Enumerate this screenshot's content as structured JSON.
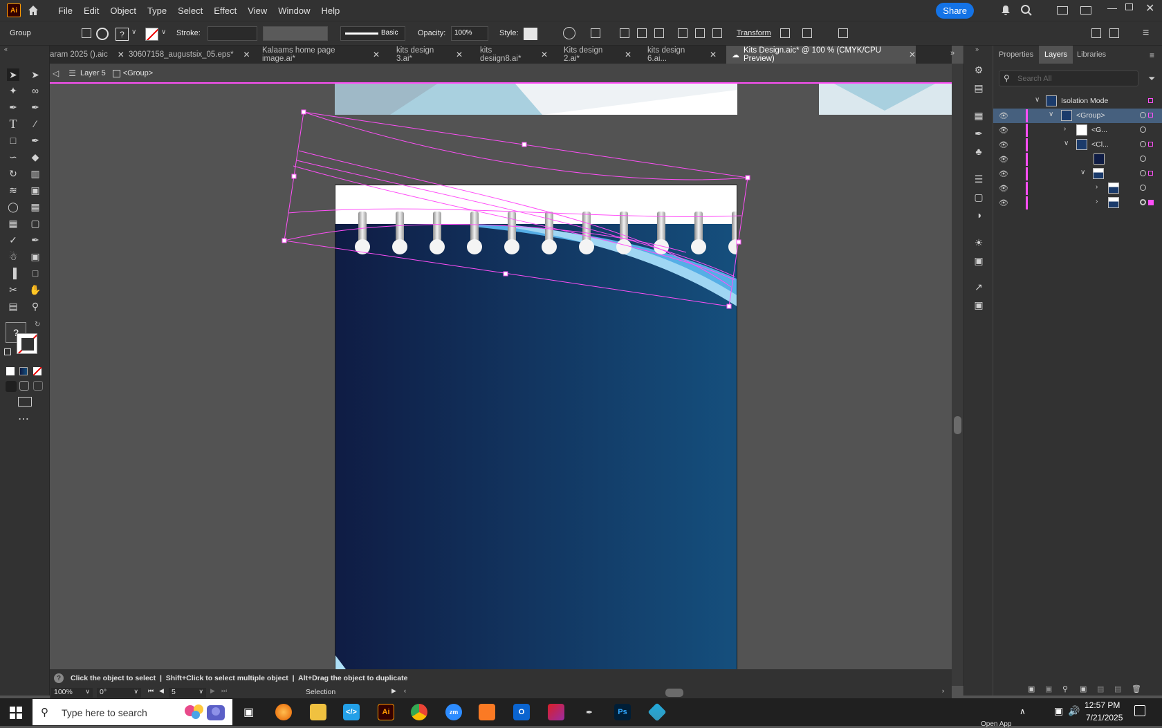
{
  "app": {
    "logo": "Ai",
    "share_label": "Share"
  },
  "menu": [
    "File",
    "Edit",
    "Object",
    "Type",
    "Select",
    "Effect",
    "View",
    "Window",
    "Help"
  ],
  "control_bar": {
    "selection_type": "Group",
    "stroke_label": "Stroke:",
    "brush_label": "Basic",
    "opacity_label": "Opacity:",
    "opacity_value": "100%",
    "style_label": "Style:",
    "transform_label": "Transform"
  },
  "tabs": [
    {
      "label": "aram 2025 ().aic"
    },
    {
      "label": "30607158_augustsix_05.eps*"
    },
    {
      "label": "Kalaams home page image.ai*"
    },
    {
      "label": "kits design 3.ai*"
    },
    {
      "label": "kits desiign8.ai*"
    },
    {
      "label": "Kits design 2.ai*"
    },
    {
      "label": "kits design 6.ai..."
    },
    {
      "label": "Kits Design.aic* @ 100 % (CMYK/CPU Preview)"
    }
  ],
  "breadcrumb": {
    "layer": "Layer 5",
    "group": "<Group>"
  },
  "panel": {
    "tabs": [
      "Properties",
      "Layers",
      "Libraries"
    ],
    "search_placeholder": "Search All",
    "layers": [
      {
        "name": "Isolation Mode"
      },
      {
        "name": "<Group>"
      },
      {
        "name": "<G..."
      },
      {
        "name": "<Cl..."
      },
      {
        "name": ""
      },
      {
        "name": ""
      },
      {
        "name": ""
      },
      {
        "name": ""
      }
    ]
  },
  "status": {
    "hint": "Click the object to select  |  Shift+Click to select multiple object  |  Alt+Drag the object to duplicate",
    "zoom": "100%",
    "rotation": "0°",
    "artboard": "5",
    "tool": "Selection"
  },
  "taskbar": {
    "search_placeholder": "Type here to search",
    "time": "12:57 PM",
    "date": "7/21/2025",
    "tooltip": "Open App"
  },
  "colors": {
    "accent": "#1473e6",
    "selection": "#ff4ff8",
    "artboard_dark": "#0f1c44",
    "artboard_light": "#154f7d"
  }
}
